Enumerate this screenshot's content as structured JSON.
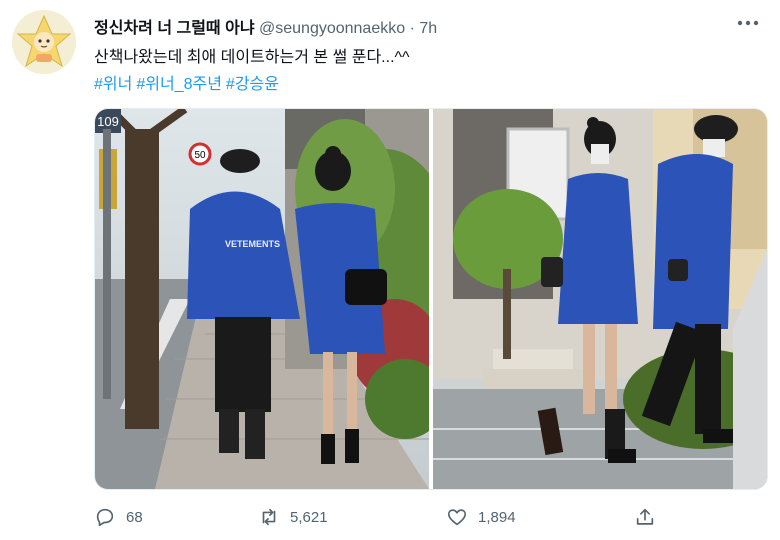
{
  "author": {
    "display_name": "정신차려 너 그럴때 아냐",
    "handle": "@seungyoonnaekko",
    "separator": "·",
    "time": "7h"
  },
  "tweet": {
    "text": "산책나왔는데 최애 데이트하는거 본 썰 푼다...^^",
    "hashtags": [
      "#위너",
      "#위너_8주년",
      "#강승윤"
    ]
  },
  "media": {
    "photos": [
      {
        "description": "couple-walking-away-left"
      },
      {
        "description": "couple-walking-side-right"
      }
    ],
    "sign_text": "109",
    "speed_sign": "50",
    "jacket_text": "VETEMENTS"
  },
  "actions": {
    "replies": "68",
    "retweets": "5,621",
    "likes": "1,894"
  },
  "colors": {
    "accent": "#1d9bf0",
    "muted": "#536471",
    "jacket_blue": "#2b53b8"
  }
}
